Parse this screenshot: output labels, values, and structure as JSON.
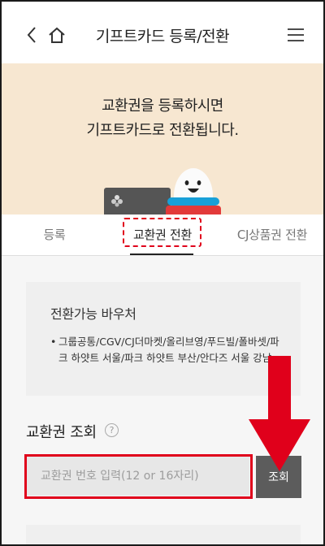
{
  "header": {
    "title": "기프트카드 등록/전환",
    "back_icon": "chevron-left-icon",
    "home_icon": "home-icon",
    "menu_icon": "hamburger-menu-icon"
  },
  "banner": {
    "line1": "교환권을 등록하시면",
    "line2": "기프트카드로 전환됩니다.",
    "background": "#f7e7d1"
  },
  "tabs": [
    {
      "label": "등록",
      "active": false
    },
    {
      "label": "교환권 전환",
      "active": true
    },
    {
      "label": "CJ상품권 전환",
      "active": false
    }
  ],
  "voucher": {
    "title": "전환가능 바우처",
    "bullet": "•",
    "items": "그룹공통/CGV/CJ더마켓/올리브영/푸드빌/폴바셋/파크 하얏트 서울/파크 하얏트 부산/안다즈 서울 강남"
  },
  "lookup": {
    "title": "교환권 조회",
    "help": "?",
    "placeholder": "교환권 번호 입력(12 or 16자리)",
    "button_label": "조회"
  },
  "colors": {
    "highlight_red": "#e0001b",
    "button_gray": "#5c5c5c"
  }
}
